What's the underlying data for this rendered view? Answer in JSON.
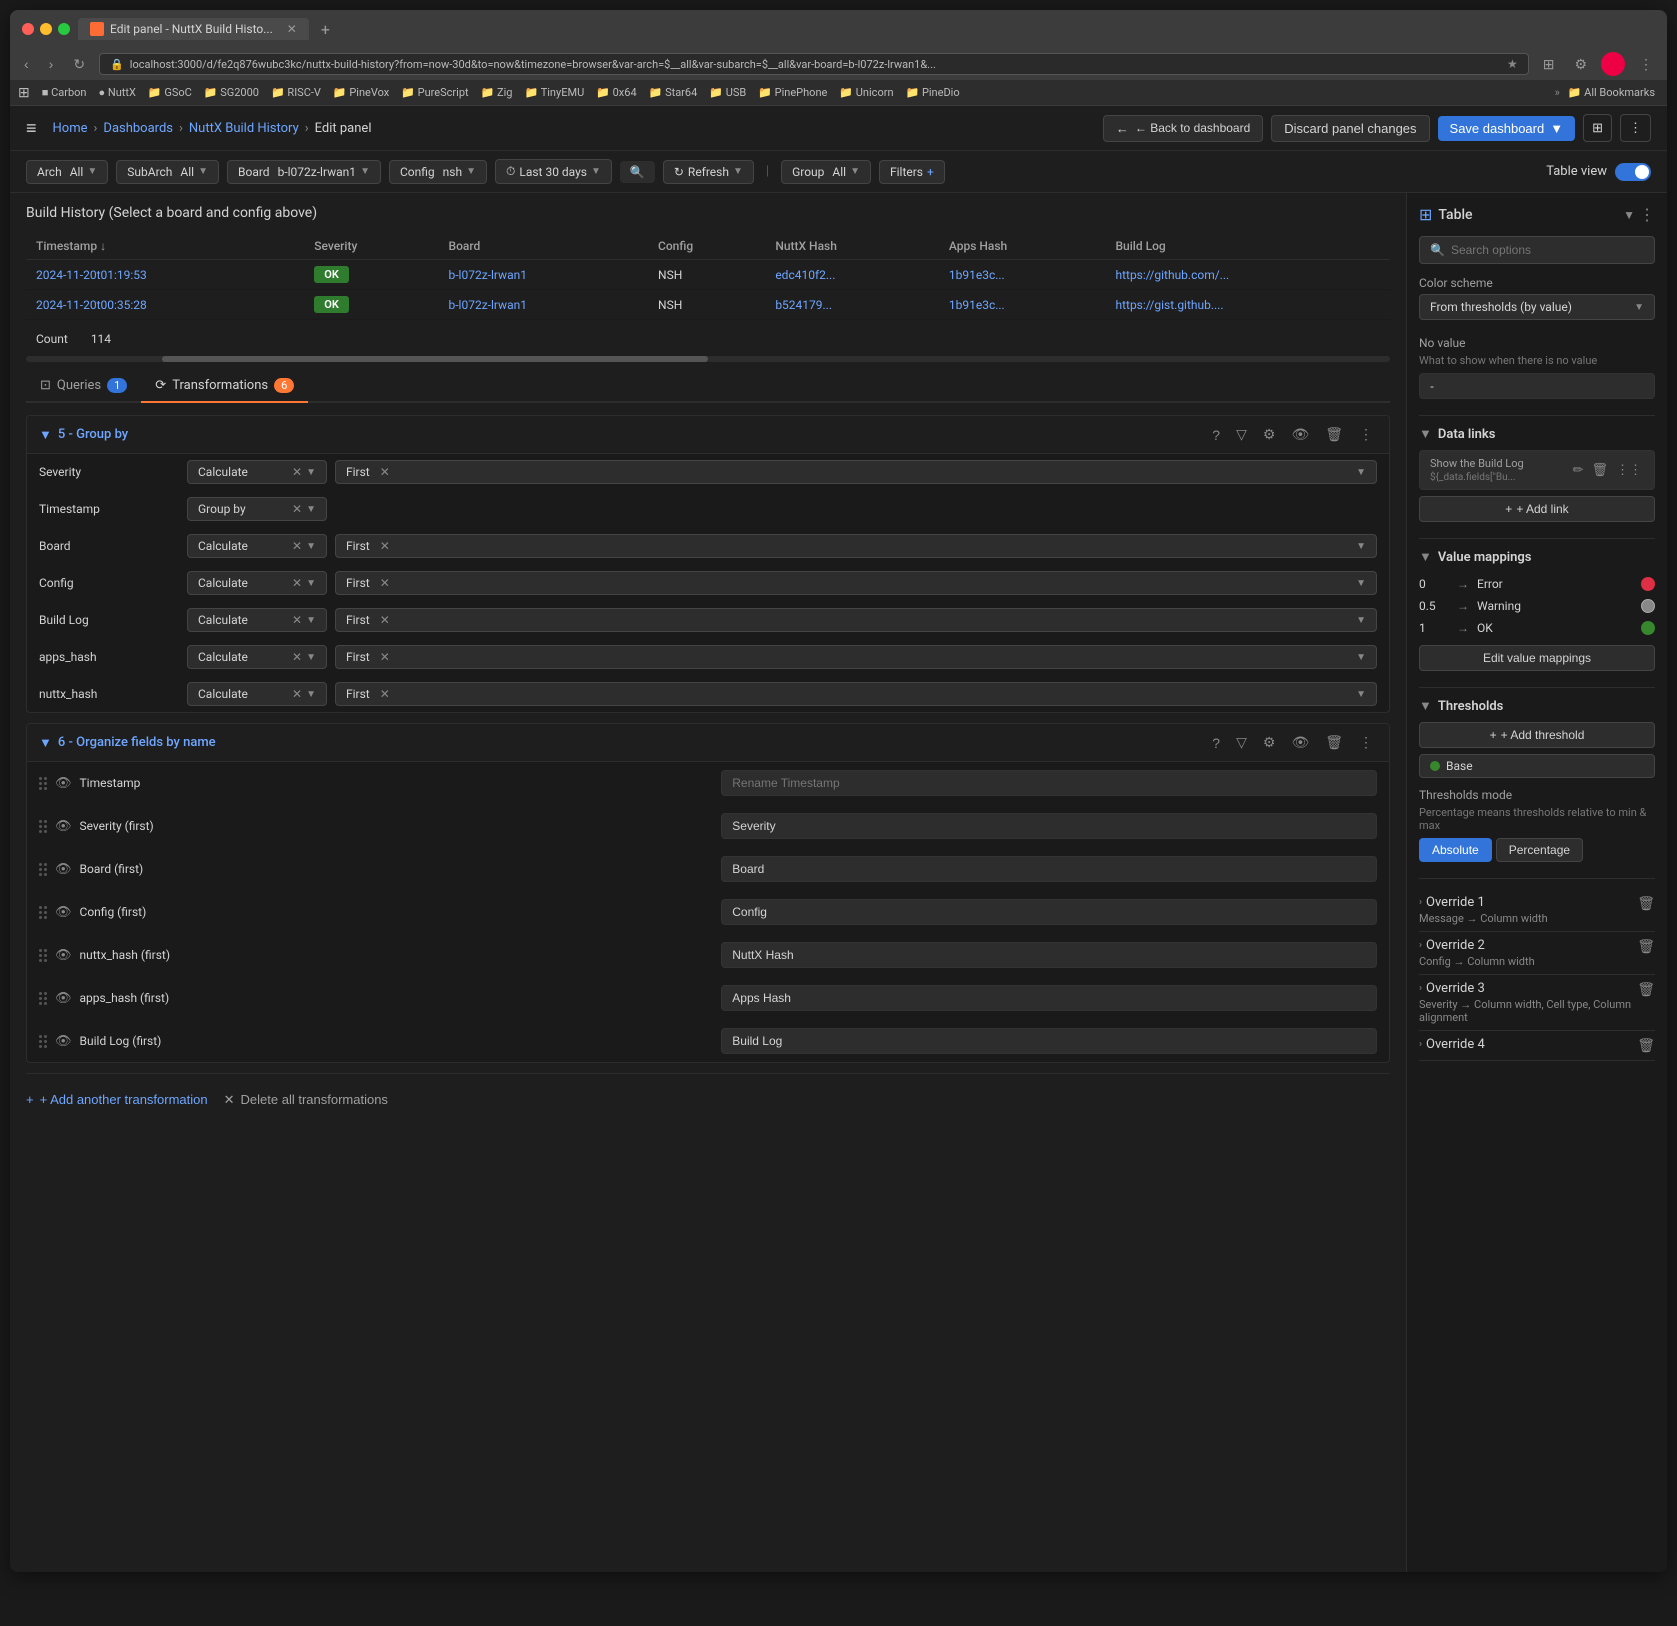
{
  "browser": {
    "tab_title": "Edit panel - NuttX Build Histo...",
    "url": "localhost:3000/d/fe2q876wubc3kc/nuttx-build-history?from=now-30d&to=now&timezone=browser&var-arch=$__all&var-subarch=$__all&var-board=b-l072z-lrwan1&..."
  },
  "bookmarks": {
    "items": [
      "Carbon",
      "NuttX",
      "GSoC",
      "SG2000",
      "RISC-V",
      "PineVox",
      "PureScript",
      "Zig",
      "TinyEMU",
      "0x64",
      "Star64",
      "USB",
      "PinePhone",
      "Unicorn",
      "PineDio"
    ],
    "all_label": "All Bookmarks"
  },
  "header": {
    "menu_icon": "≡",
    "breadcrumb": [
      "Home",
      "Dashboards",
      "NuttX Build History",
      "Edit panel"
    ],
    "back_btn": "← Back to dashboard",
    "discard_btn": "Discard panel changes",
    "save_btn": "Save dashboard",
    "dropdown_icon": "▼"
  },
  "toolbar": {
    "arch_label": "Arch",
    "arch_value": "All",
    "subarch_label": "SubArch",
    "subarch_value": "All",
    "board_label": "Board",
    "board_value": "b-l072z-lrwan1",
    "config_label": "Config",
    "config_value": "nsh",
    "time_range": "Last 30 days",
    "refresh_label": "Refresh",
    "group_label": "Group",
    "group_value": "All",
    "filters_label": "Filters",
    "table_view_label": "Table view"
  },
  "preview": {
    "title": "Build History (Select a board and config above)",
    "columns": [
      "Timestamp ↓",
      "Severity",
      "Board",
      "Config",
      "NuttX Hash",
      "Apps Hash",
      "Build Log"
    ],
    "rows": [
      {
        "timestamp": "2024-11-20t01:19:53",
        "severity": "OK",
        "board": "b-l072z-lrwan1",
        "config": "NSH",
        "nuttx_hash": "edc410f2...",
        "apps_hash": "1b91e3c...",
        "build_log": "https://github.com/..."
      },
      {
        "timestamp": "2024-11-20t00:35:28",
        "severity": "OK",
        "board": "b-l072z-lrwan1",
        "config": "NSH",
        "nuttx_hash": "b524179...",
        "apps_hash": "1b91e3c...",
        "build_log": "https://gist.github...."
      }
    ],
    "count_label": "Count",
    "count_value": "114"
  },
  "tabs": {
    "queries_label": "Queries",
    "queries_count": "1",
    "transformations_label": "Transformations",
    "transformations_count": "6"
  },
  "transformations": {
    "group_by": {
      "title": "5 - Group by",
      "fields": [
        {
          "name": "Severity",
          "operation": "Calculate",
          "agg": "First"
        },
        {
          "name": "Timestamp",
          "operation": "Group by",
          "agg": null
        },
        {
          "name": "Board",
          "operation": "Calculate",
          "agg": "First"
        },
        {
          "name": "Config",
          "operation": "Calculate",
          "agg": "First"
        },
        {
          "name": "Build Log",
          "operation": "Calculate",
          "agg": "First"
        },
        {
          "name": "apps_hash",
          "operation": "Calculate",
          "agg": "First"
        },
        {
          "name": "nuttx_hash",
          "operation": "Calculate",
          "agg": "First"
        }
      ]
    },
    "organize": {
      "title": "6 - Organize fields by name",
      "fields": [
        {
          "name": "Timestamp",
          "rename": "Rename Timestamp"
        },
        {
          "name": "Severity (first)",
          "rename": "Severity"
        },
        {
          "name": "Board (first)",
          "rename": "Board"
        },
        {
          "name": "Config (first)",
          "rename": "Config"
        },
        {
          "name": "nuttx_hash (first)",
          "rename": "NuttX Hash"
        },
        {
          "name": "apps_hash (first)",
          "rename": "Apps Hash"
        },
        {
          "name": "Build Log (first)",
          "rename": "Build Log"
        }
      ]
    },
    "add_btn": "+ Add another transformation",
    "delete_btn": "✕ Delete all transformations"
  },
  "right_panel": {
    "type_label": "Table",
    "search_placeholder": "Search options",
    "color_scheme_label": "Color scheme",
    "color_scheme_value": "From thresholds (by value)",
    "no_value_label": "No value",
    "no_value_sublabel": "What to show when there is no value",
    "no_value_placeholder": "-",
    "data_links_label": "Data links",
    "data_link_text": "Show the Build Log",
    "data_link_formula": "${_data.fields[\"Bu...",
    "add_link_btn": "+ Add link",
    "value_mappings_label": "Value mappings",
    "mappings": [
      {
        "value": "0",
        "arrow": "→",
        "label": "Error",
        "color": "red"
      },
      {
        "value": "0.5",
        "arrow": "→",
        "label": "Warning",
        "color": "gray"
      },
      {
        "value": "1",
        "arrow": "→",
        "label": "OK",
        "color": "green"
      }
    ],
    "edit_mappings_btn": "Edit value mappings",
    "thresholds_label": "Thresholds",
    "add_threshold_btn": "+ Add threshold",
    "base_label": "Base",
    "thresholds_mode_label": "Thresholds mode",
    "thresholds_mode_sub": "Percentage means thresholds relative to min & max",
    "absolute_btn": "Absolute",
    "percentage_btn": "Percentage",
    "overrides": [
      {
        "title": "Override 1",
        "detail": "Message → Column width"
      },
      {
        "title": "Override 2",
        "detail": "Config → Column width"
      },
      {
        "title": "Override 3",
        "detail": "Severity → Column width, Cell type, Column alignment"
      },
      {
        "title": "Override 4",
        "detail": ""
      }
    ]
  }
}
